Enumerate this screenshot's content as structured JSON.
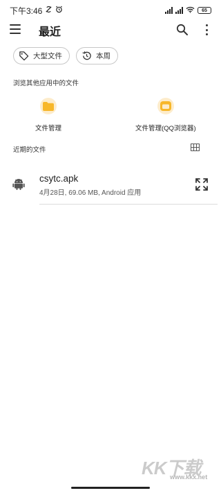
{
  "status_bar": {
    "time": "下午3:46",
    "battery": "65"
  },
  "toolbar": {
    "title": "最近",
    "menu_icon": "hamburger-menu-icon",
    "search_icon": "search-icon",
    "more_icon": "more-vert-icon"
  },
  "chips": [
    {
      "label": "大型文件",
      "icon": "tag-icon"
    },
    {
      "label": "本周",
      "icon": "history-icon"
    }
  ],
  "browse_section": {
    "title": "浏览其他应用中的文件",
    "apps": [
      {
        "label": "文件管理",
        "icon": "folder-icon"
      },
      {
        "label": "文件管理(QQ浏览器)",
        "icon": "folder-icon"
      }
    ]
  },
  "recent_section": {
    "title": "近期的文件",
    "view_toggle_icon": "grid-view-icon"
  },
  "files": [
    {
      "name": "csytc.apk",
      "meta": "4月28日, 69.06 MB, Android 应用",
      "icon": "android-icon",
      "action_icon": "expand-icon"
    }
  ],
  "watermark": {
    "text": "KK下载",
    "url": "www.kkx.net"
  },
  "colors": {
    "accent_folder": "#f7b72a",
    "accent_folder_bg": "#fdeccb",
    "divider": "#dcdcdc"
  }
}
